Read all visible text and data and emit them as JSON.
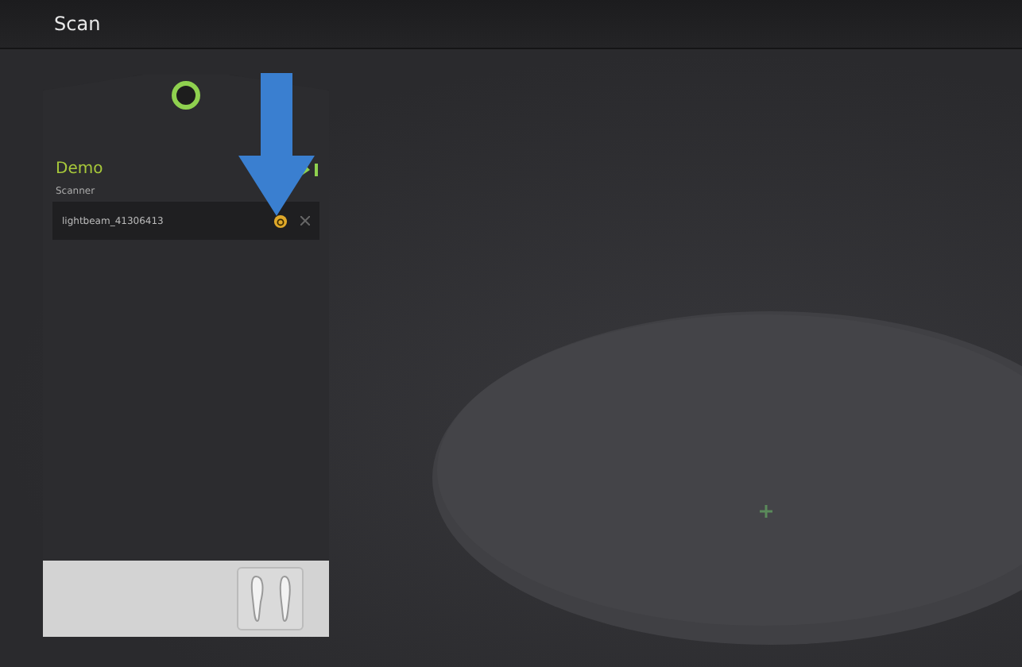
{
  "title_bar": {
    "title": "Scan"
  },
  "panel": {
    "title": "Demo",
    "section_label": "Scanner",
    "scanners": [
      {
        "name": "lightbeam_41306413",
        "selected": true
      }
    ]
  }
}
